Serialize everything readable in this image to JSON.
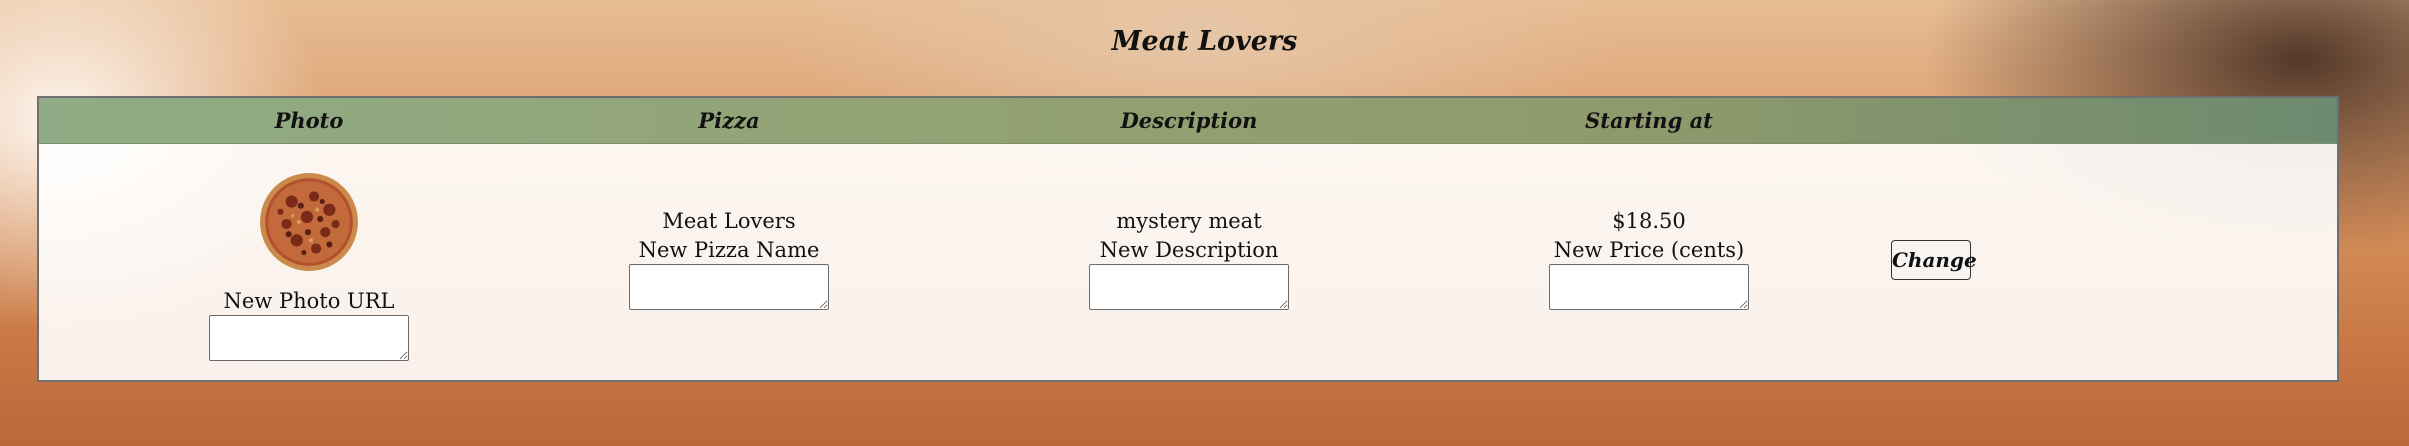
{
  "page": {
    "title": "Meat Lovers"
  },
  "table": {
    "headers": {
      "photo": "Photo",
      "pizza": "Pizza",
      "description": "Description",
      "price": "Starting at"
    },
    "row": {
      "photo_alt": "pepperoni-sausage-pizza-photo",
      "photo_field_label": "New Photo URL",
      "pizza_name": "Meat Lovers",
      "pizza_field_label": "New Pizza Name",
      "description": "mystery meat",
      "description_field_label": "New Description",
      "price": "$18.50",
      "price_field_label": "New Price (cents)",
      "change_label": "Change"
    }
  },
  "colors": {
    "header_green": "#8fa279",
    "panel_bg": "#fbf6f2",
    "border": "#6f6f6f"
  }
}
